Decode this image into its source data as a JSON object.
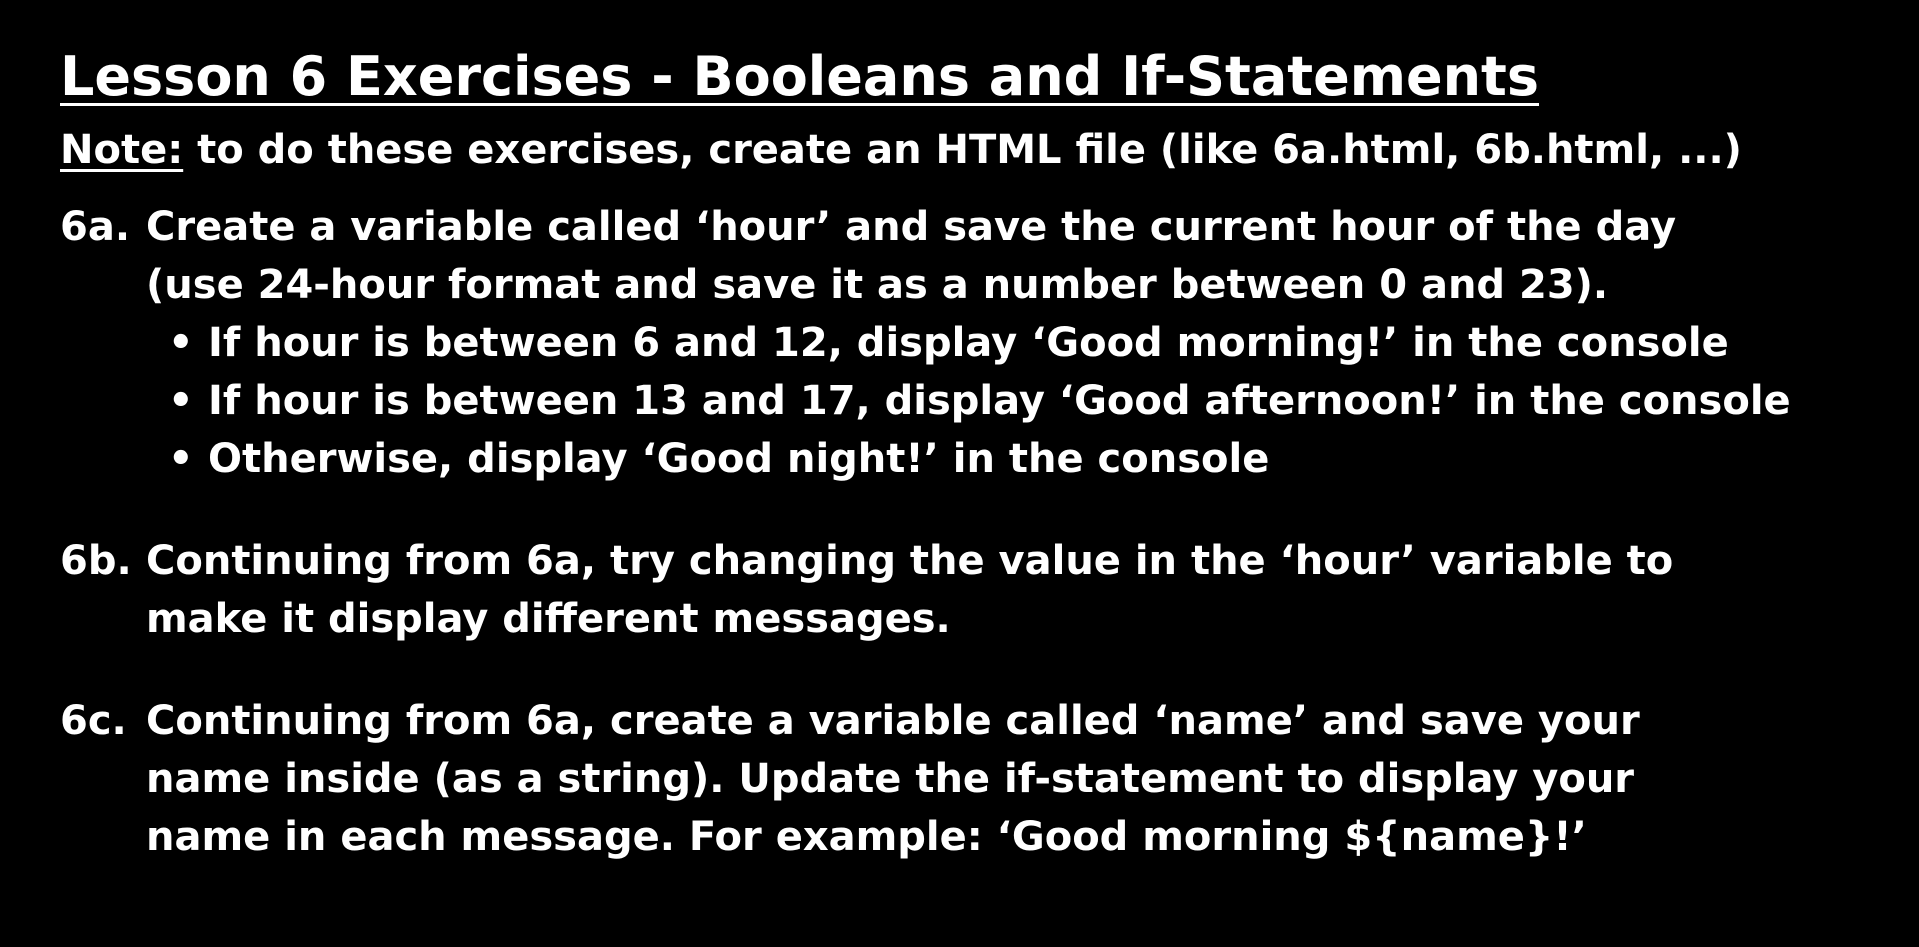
{
  "title": "Lesson 6 Exercises - Booleans and If-Statements",
  "note": {
    "label": "Note:",
    "text": " to do these exercises, create an HTML file (like 6a.html, 6b.html, ...)"
  },
  "exercises": [
    {
      "number": "6a.",
      "lines": [
        "Create a variable called ‘hour’ and save the current hour of the day",
        "(use 24-hour format and save it as a number between 0 and 23)."
      ],
      "bullets": [
        "If hour is between 6 and 12, display ‘Good morning!’ in the console",
        "If hour is between 13 and 17, display ‘Good afternoon!’ in the console",
        "Otherwise, display ‘Good night!’ in the console"
      ]
    },
    {
      "number": "6b.",
      "lines": [
        "Continuing from 6a, try changing the value in the ‘hour’ variable to",
        "make it display different messages."
      ]
    },
    {
      "number": "6c.",
      "lines": [
        "Continuing from 6a, create a variable called ‘name’ and save your",
        "name inside (as a string). Update the if-statement to display your",
        "name in each message. For example: ‘Good morning ${name}!’"
      ]
    }
  ],
  "colors": {
    "background": "#000000",
    "text": "#ffffff"
  }
}
